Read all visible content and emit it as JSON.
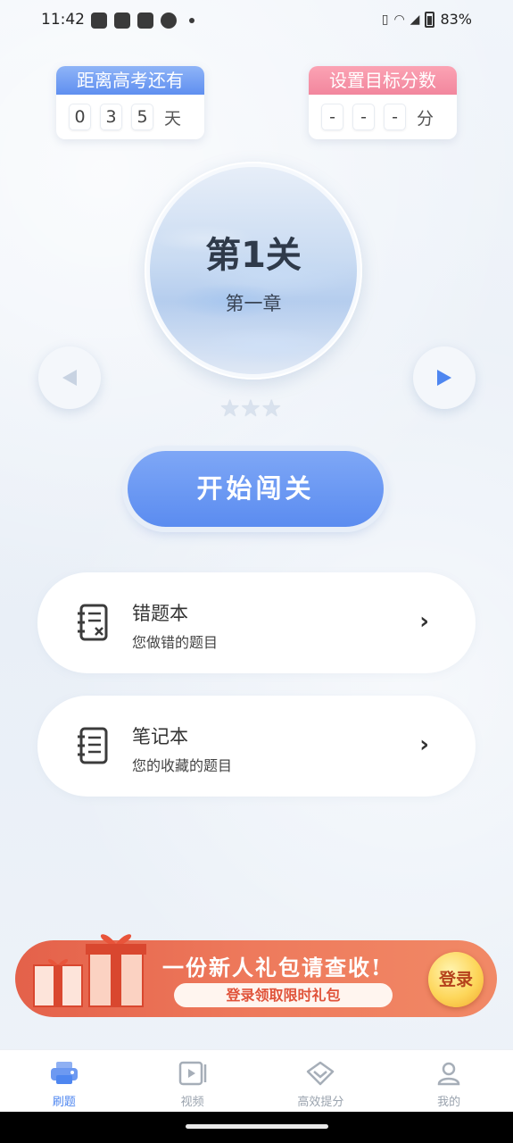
{
  "status_bar": {
    "time": "11:42",
    "battery": "83%"
  },
  "countdown": {
    "title": "距离高考还有",
    "digits": [
      "0",
      "3",
      "5"
    ],
    "unit": "天"
  },
  "target_score": {
    "title": "设置目标分数",
    "digits": [
      "-",
      "-",
      "-"
    ],
    "unit": "分"
  },
  "level": {
    "title": "第1关",
    "chapter": "第一章",
    "stars": "★★★"
  },
  "nav": {
    "prev_icon": "triangle-left-icon",
    "next_icon": "triangle-right-icon"
  },
  "start_button": "开始闯关",
  "menu": [
    {
      "title": "错题本",
      "subtitle": "您做错的题目",
      "icon": "wrong-notebook-icon"
    },
    {
      "title": "笔记本",
      "subtitle": "您的收藏的题目",
      "icon": "notebook-icon"
    }
  ],
  "promo": {
    "title": "一份新人礼包请查收!",
    "subtitle": "登录领取限时礼包",
    "login": "登录"
  },
  "tabs": [
    {
      "label": "刷题",
      "icon": "practice-icon",
      "active": true
    },
    {
      "label": "视频",
      "icon": "video-icon",
      "active": false
    },
    {
      "label": "高效提分",
      "icon": "score-up-icon",
      "active": false
    },
    {
      "label": "我的",
      "icon": "profile-icon",
      "active": false
    }
  ],
  "colors": {
    "accent": "#4e86f0",
    "pink": "#f2869d",
    "promo": "#e4614a"
  }
}
